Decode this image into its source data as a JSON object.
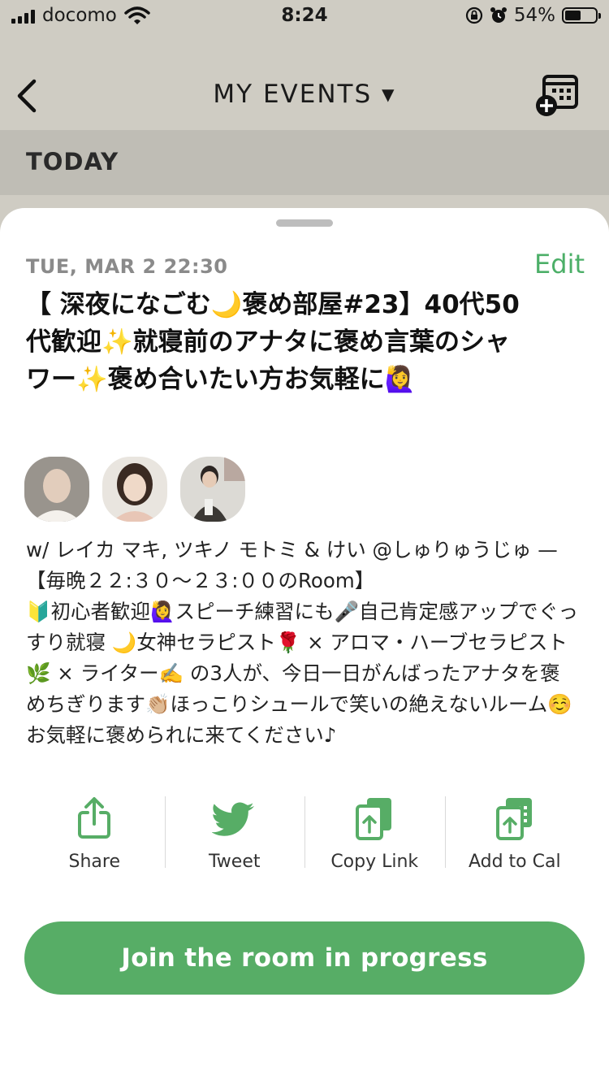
{
  "status_bar": {
    "carrier": "docomo",
    "time": "8:24",
    "battery": "54%",
    "battery_level": 0.54
  },
  "nav": {
    "title": "MY EVENTS ▾"
  },
  "section": {
    "label": "TODAY"
  },
  "event": {
    "date": "TUE, MAR 2 22:30",
    "edit_label": "Edit",
    "title": "【 深夜になごむ🌙褒め部屋#23】40代50代歓迎✨就寝前のアナタに褒め言葉のシャワー✨褒め合いたい方お気軽に🙋‍♀️",
    "description": "w/ レイカ マキ, ツキノ モトミ & けい @しゅりゅうじゅ — 【毎晩２２:３０〜２３:００のRoom】\n🔰初心者歓迎🙋‍♀️スピーチ練習にも🎤自己肯定感アップでぐっすり就寝 🌙女神セラピスト🌹 × アロマ・ハーブセラピスト🌿 × ライター✍️ の3人が、今日一日がんばったアナタを褒めちぎります👏🏼ほっこりシュールで笑いの絶えないルーム☺️お気軽に褒められに来てください♪"
  },
  "actions": [
    {
      "label": "Share",
      "icon": "share-icon"
    },
    {
      "label": "Tweet",
      "icon": "twitter-icon"
    },
    {
      "label": "Copy Link",
      "icon": "copy-link-icon"
    },
    {
      "label": "Add to Cal",
      "icon": "add-to-calendar-icon"
    }
  ],
  "join_button": {
    "label": "Join the room in progress"
  },
  "colors": {
    "accent": "#57ad66",
    "header_bg": "#cfccc3",
    "section_bg": "#bfbdb5"
  }
}
